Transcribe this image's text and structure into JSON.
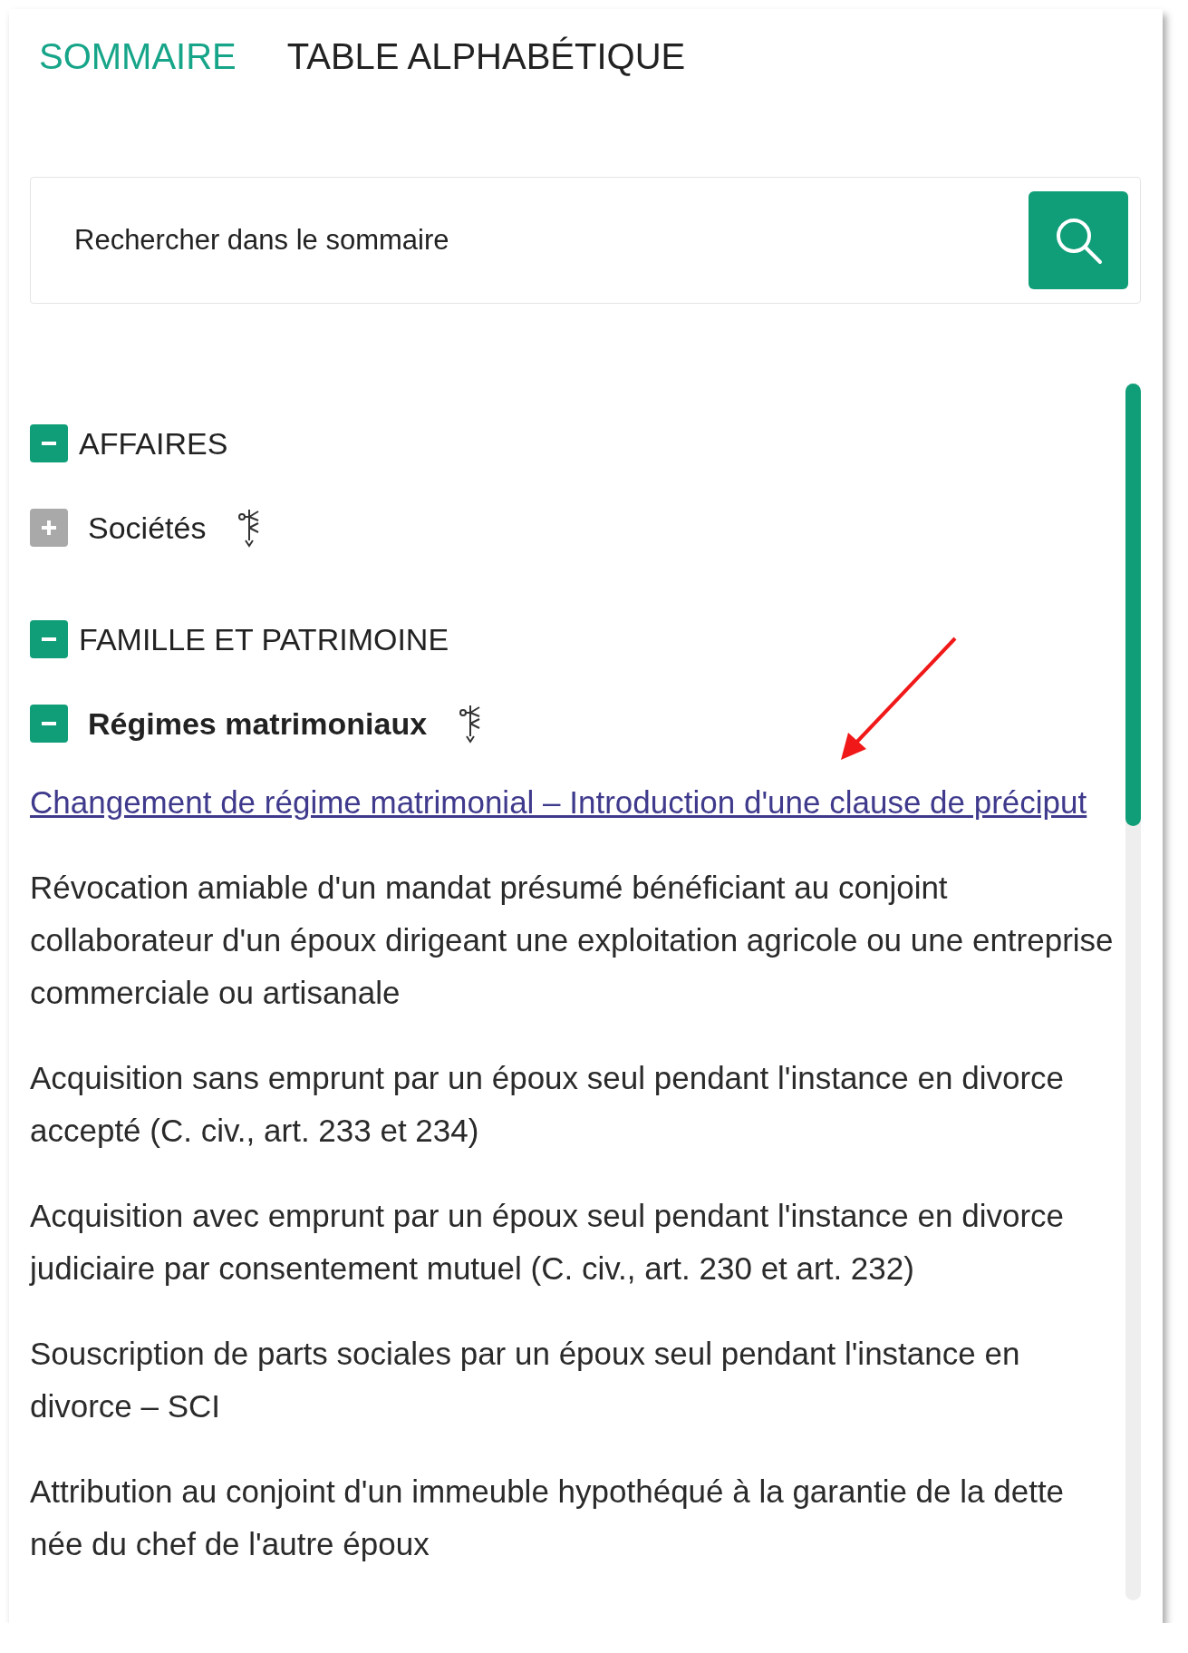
{
  "tabs": [
    {
      "label": "SOMMAIRE",
      "selected": true
    },
    {
      "label": "TABLE ALPHABÉTIQUE",
      "selected": false
    }
  ],
  "search": {
    "placeholder": "Rechercher dans le sommaire"
  },
  "tree": [
    {
      "kind": "section",
      "label": "AFFAIRES",
      "expanded": true,
      "children": [
        {
          "kind": "topic",
          "label": "Sociétés",
          "expanded": false
        }
      ]
    },
    {
      "kind": "section",
      "label": "FAMILLE ET PATRIMOINE",
      "expanded": true,
      "children": [
        {
          "kind": "topic",
          "label": "Régimes matrimoniaux",
          "expanded": true,
          "documents": [
            {
              "label": "Changement de régime matrimonial – Introduction d'une clause de préciput",
              "selected": true
            },
            {
              "label": "Révocation amiable d'un mandat présumé bénéficiant au conjoint collaborateur d'un époux dirigeant une exploitation agricole ou une entreprise commerciale ou artisanale",
              "selected": false
            },
            {
              "label": "Acquisition sans emprunt par un époux seul pendant l'instance en divorce accepté (C. civ., art. 233 et 234)",
              "selected": false
            },
            {
              "label": "Acquisition avec emprunt par un époux seul pendant l'instance en divorce judiciaire par consentement mutuel (C. civ., art. 230 et art. 232)",
              "selected": false
            },
            {
              "label": "Souscription de parts sociales par un époux seul pendant l'instance en divorce – SCI",
              "selected": false
            },
            {
              "label": "Attribution au conjoint d'un immeuble hypothéqué à la garantie de la dette née du chef de l'autre époux",
              "selected": false
            }
          ]
        }
      ]
    }
  ]
}
